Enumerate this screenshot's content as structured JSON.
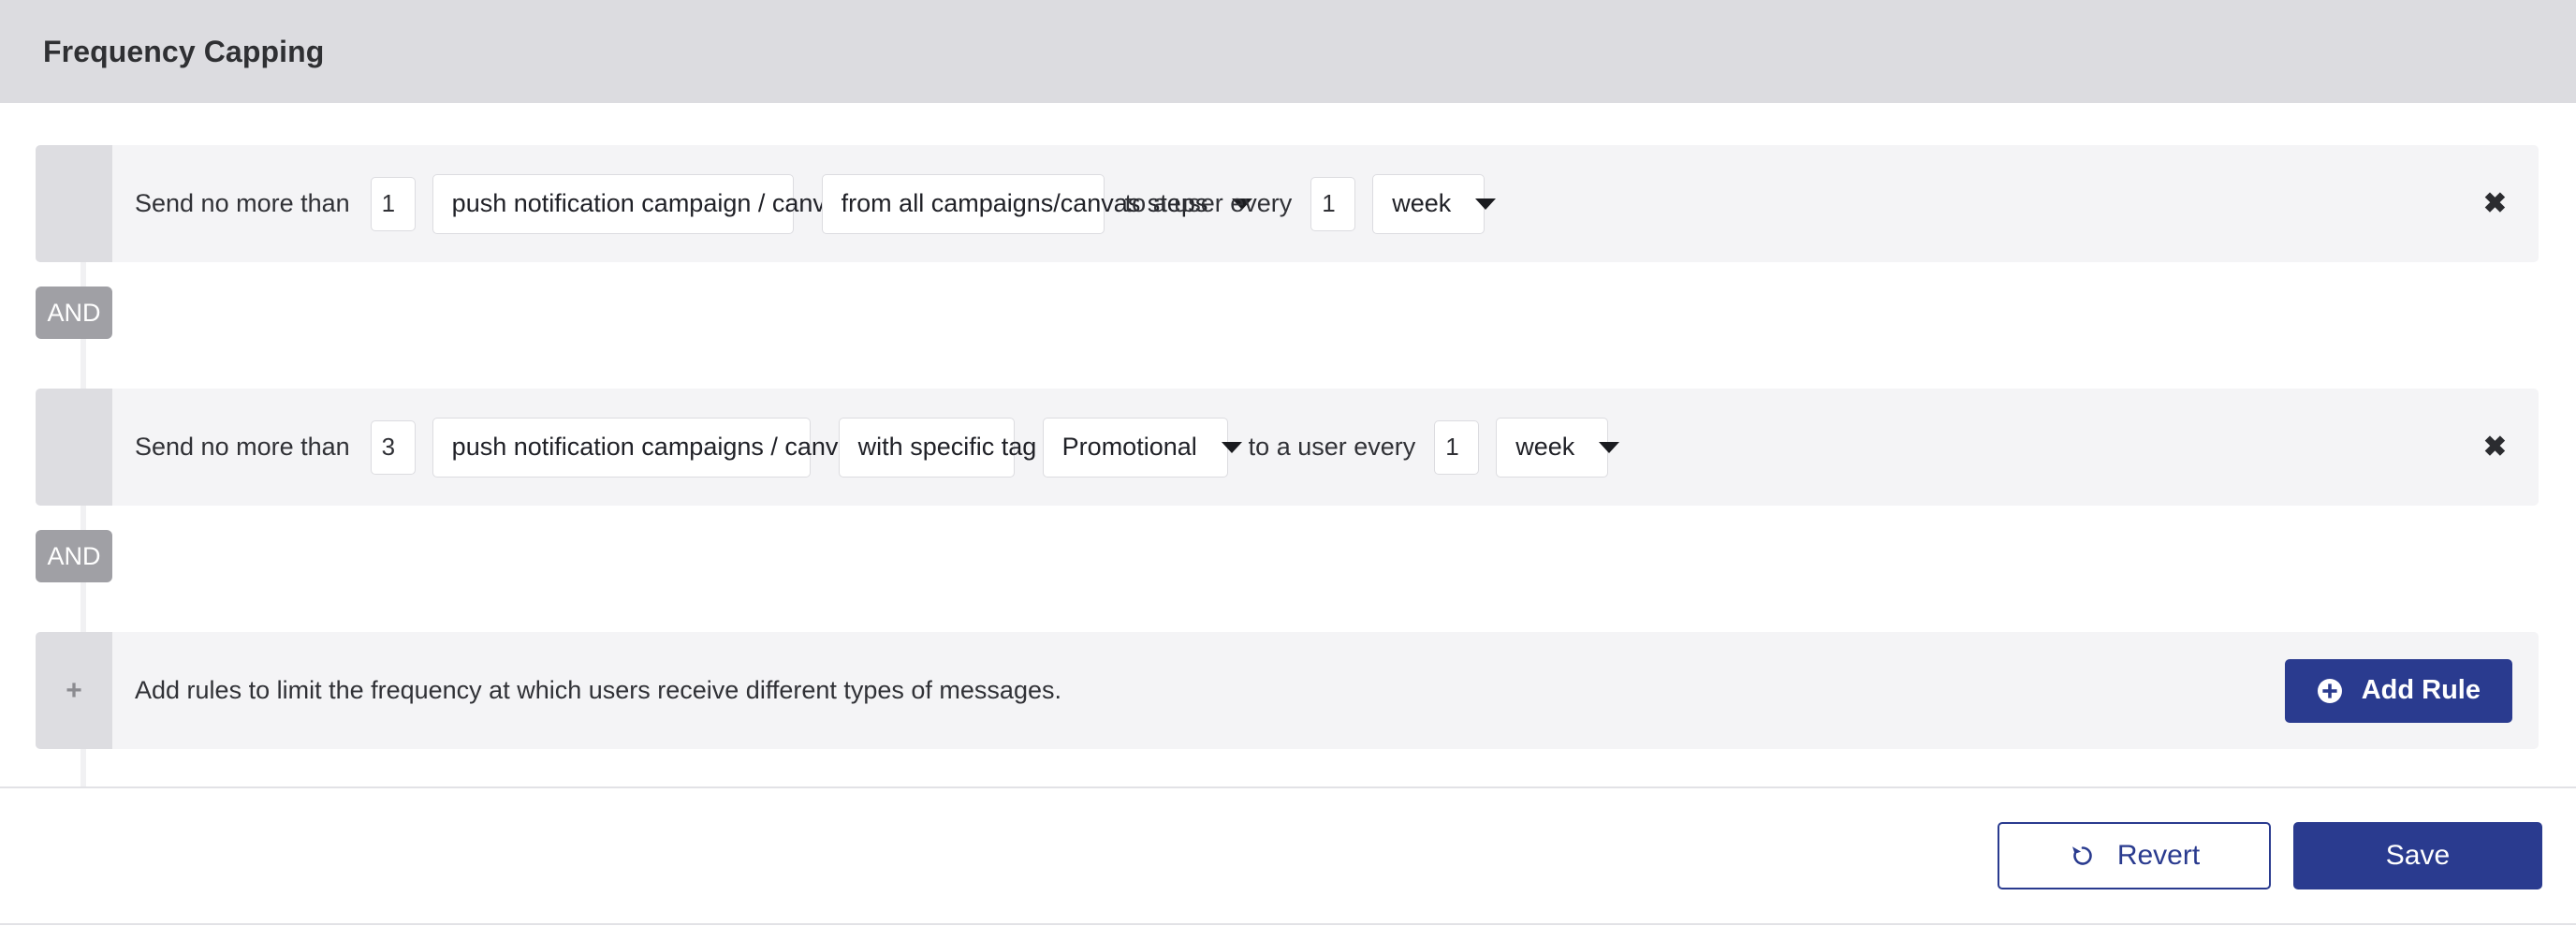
{
  "header": {
    "title": "Frequency Capping"
  },
  "colors": {
    "header_bg": "#dcdce0",
    "row_bg": "#f4f4f6",
    "handle_bg": "#dddde1",
    "and_badge_bg": "#a0a0a5",
    "primary": "#2a3b8f",
    "text": "#303136"
  },
  "rules": [
    {
      "lead_label": "Send no more than",
      "count_value": "1",
      "count_placeholder": "1",
      "message_type": "push notification campaign / canvas step",
      "scope": "from all campaigns/canvas steps",
      "tag": null,
      "every_label": "to a user every",
      "interval_value": "1",
      "interval_placeholder": "1",
      "interval_unit": "week",
      "remove_icon": "✖"
    },
    {
      "lead_label": "Send no more than",
      "count_value": "3",
      "count_placeholder": "1",
      "message_type": "push notification campaigns / canvas steps",
      "scope": "with specific tag",
      "tag": "Promotional",
      "every_label": "to a user every",
      "interval_value": "1",
      "interval_placeholder": "1",
      "interval_unit": "week",
      "remove_icon": "✖"
    }
  ],
  "connectors": [
    {
      "label": "AND"
    },
    {
      "label": "AND"
    }
  ],
  "add_rule_row": {
    "handle_icon": "+",
    "description": "Add rules to limit the frequency at which users receive different types of messages.",
    "button_label": "Add Rule"
  },
  "footer": {
    "revert_label": "Revert",
    "save_label": "Save"
  }
}
